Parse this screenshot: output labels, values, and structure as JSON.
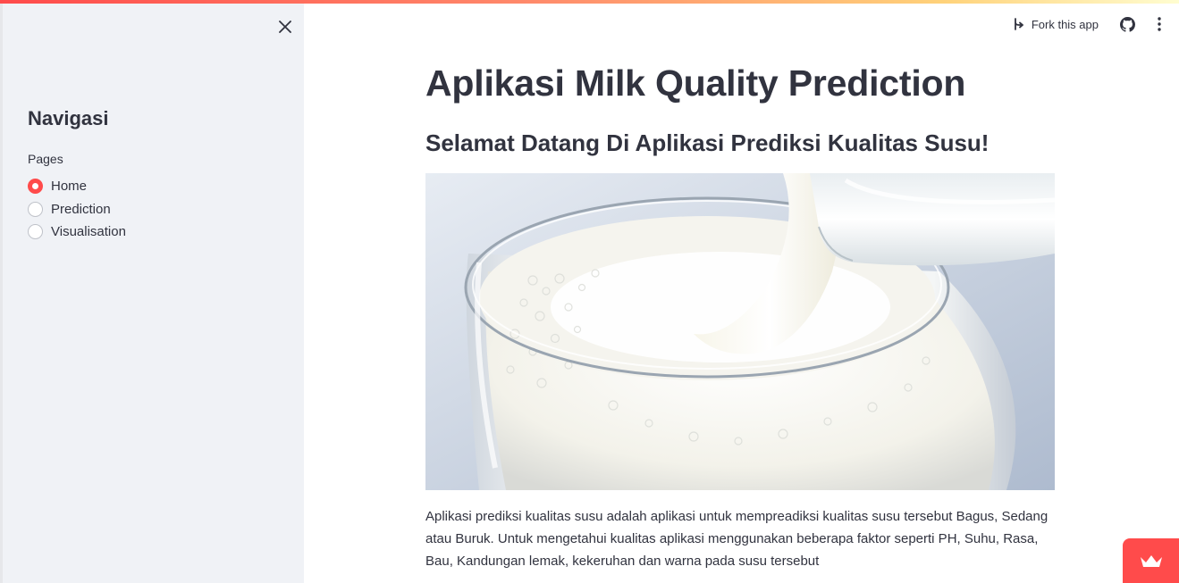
{
  "sidebar": {
    "title": "Navigasi",
    "radio_label": "Pages",
    "options": [
      "Home",
      "Prediction",
      "Visualisation"
    ],
    "selected": "Home"
  },
  "toolbar": {
    "fork_label": "Fork this app"
  },
  "main": {
    "title": "Aplikasi Milk Quality Prediction",
    "subtitle": "Selamat Datang Di Aplikasi Prediksi Kualitas Susu!",
    "paragraph": "Aplikasi prediksi kualitas susu adalah aplikasi untuk mempreadiksi kualitas susu tersebut Bagus, Sedang atau Buruk. Untuk mengetahui kualitas aplikasi menggunakan beberapa faktor seperti PH, Suhu, Rasa, Bau, Kandungan lemak, kekeruhan dan warna pada susu tersebut"
  },
  "colors": {
    "accent": "#ff4b4b",
    "sidebar_bg": "#f0f2f6",
    "text": "#31333f"
  },
  "icons": {
    "close": "close-icon",
    "fork": "fork-icon",
    "github": "github-icon",
    "menu": "kebab-menu-icon",
    "badge": "crown-icon"
  }
}
